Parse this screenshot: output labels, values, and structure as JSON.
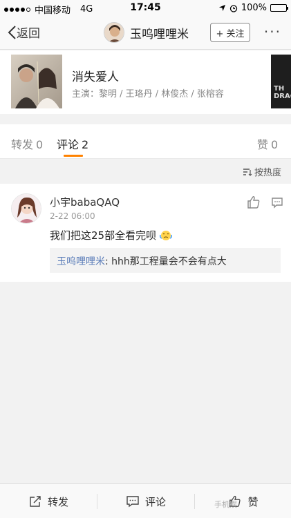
{
  "status_bar": {
    "carrier": "中国移动",
    "network": "4G",
    "time": "17:45",
    "battery": "100%",
    "battery_level": 1.0
  },
  "nav": {
    "back_label": "返回",
    "title": "玉呜哩哩米",
    "follow_label": "+ 关注",
    "more_label": "···"
  },
  "movie": {
    "title": "消失爱人",
    "cast": "主演：黎明 / 王珞丹 / 林俊杰 / 张榕容",
    "side_poster_text": "TH DRAG"
  },
  "tabs": [
    {
      "label": "转发",
      "count": "0"
    },
    {
      "label": "评论",
      "count": "2"
    },
    {
      "label": "赞",
      "count": "0"
    }
  ],
  "sort_label": "按热度",
  "comment": {
    "user": "小宇babaQAQ",
    "time": "2-22 06:00",
    "text": "我们把这25部全看完呗",
    "reply_user": "玉呜哩哩米",
    "reply_text": ": hhh那工程量会不会有点大"
  },
  "bottom_bar": {
    "repost_label": "转发",
    "comment_label": "评论",
    "like_label": "赞"
  },
  "watermark": "手机娱"
}
